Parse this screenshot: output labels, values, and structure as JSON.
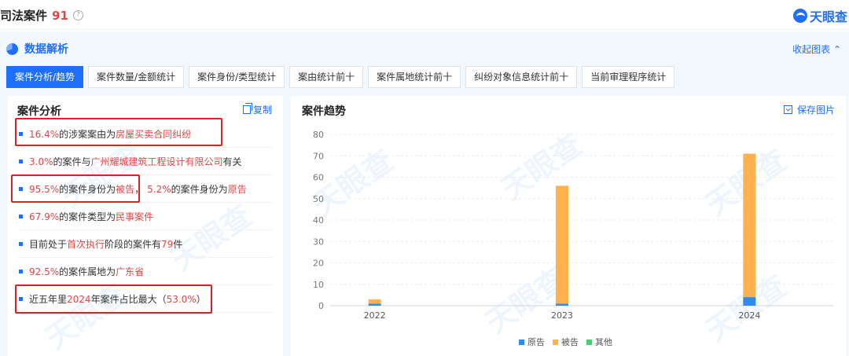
{
  "header": {
    "title": "司法案件",
    "count": "91",
    "help_icon": "question-icon",
    "brand": "天眼查",
    "brand_icon": "tianyancha-logo-icon"
  },
  "panel": {
    "title": "数据解析",
    "title_icon": "pie-chart-icon",
    "collapse_label": "收起图表",
    "tabs": [
      "案件分析/趋势",
      "案件数量/金额统计",
      "案件身份/类型统计",
      "案由统计前十",
      "案件属地统计前十",
      "纠纷对象信息统计前十",
      "当前审理程序统计"
    ],
    "active_tab": 0
  },
  "analysis": {
    "title": "案件分析",
    "copy_label": "复制",
    "items": [
      {
        "p1": "16.4%",
        "t1": "的涉案案由为",
        "p2": "房屋买卖合同纠纷",
        "t2": "",
        "p3": "",
        "t3": ""
      },
      {
        "p1": "3.0%",
        "t1": "的案件与",
        "p2": "广州耀城建筑工程设计有限公司",
        "t2": "有关",
        "p3": "",
        "t3": ""
      },
      {
        "p1": "95.5%",
        "t1": "的案件身份为",
        "p2": "被告",
        "t2": "，",
        "p3": "5.2%",
        "t3": "的案件身份为",
        "p4": "原告"
      },
      {
        "p1": "67.9%",
        "t1": "的案件类型为",
        "p2": "民事案件",
        "t2": "",
        "p3": "",
        "t3": ""
      },
      {
        "t0": "目前处于",
        "p1": "首次执行",
        "t1": "阶段的案件有",
        "p2": "79",
        "t2": "件",
        "p3": "",
        "t3": ""
      },
      {
        "p1": "92.5%",
        "t1": "的案件属地为",
        "p2": "广东省",
        "t2": "",
        "p3": "",
        "t3": ""
      },
      {
        "t0": "近五年里",
        "p1": "2024",
        "t1": "年案件占比最大（",
        "p2": "53.0%",
        "t2": "）",
        "p3": "",
        "t3": ""
      }
    ]
  },
  "trend": {
    "title": "案件趋势",
    "save_label": "保存图片",
    "watermark": "天眼查"
  },
  "colors": {
    "accent": "#1e6fff",
    "highlight": "#e54545",
    "plaintiff": "#2d8cf0",
    "defendant": "#ffb04f",
    "other": "#52c77a"
  },
  "chart_data": {
    "type": "bar",
    "stacked": true,
    "categories": [
      "2022",
      "2023",
      "2024"
    ],
    "series": [
      {
        "name": "原告",
        "color": "#2d8cf0",
        "values": [
          1,
          1,
          4
        ]
      },
      {
        "name": "被告",
        "color": "#ffb04f",
        "values": [
          2,
          55,
          67
        ]
      },
      {
        "name": "其他",
        "color": "#52c77a",
        "values": [
          0,
          0,
          0
        ]
      }
    ],
    "ylim": [
      0,
      80
    ],
    "yticks": [
      0,
      10,
      20,
      30,
      40,
      50,
      60,
      70,
      80
    ],
    "grid": true,
    "legend_position": "bottom"
  }
}
